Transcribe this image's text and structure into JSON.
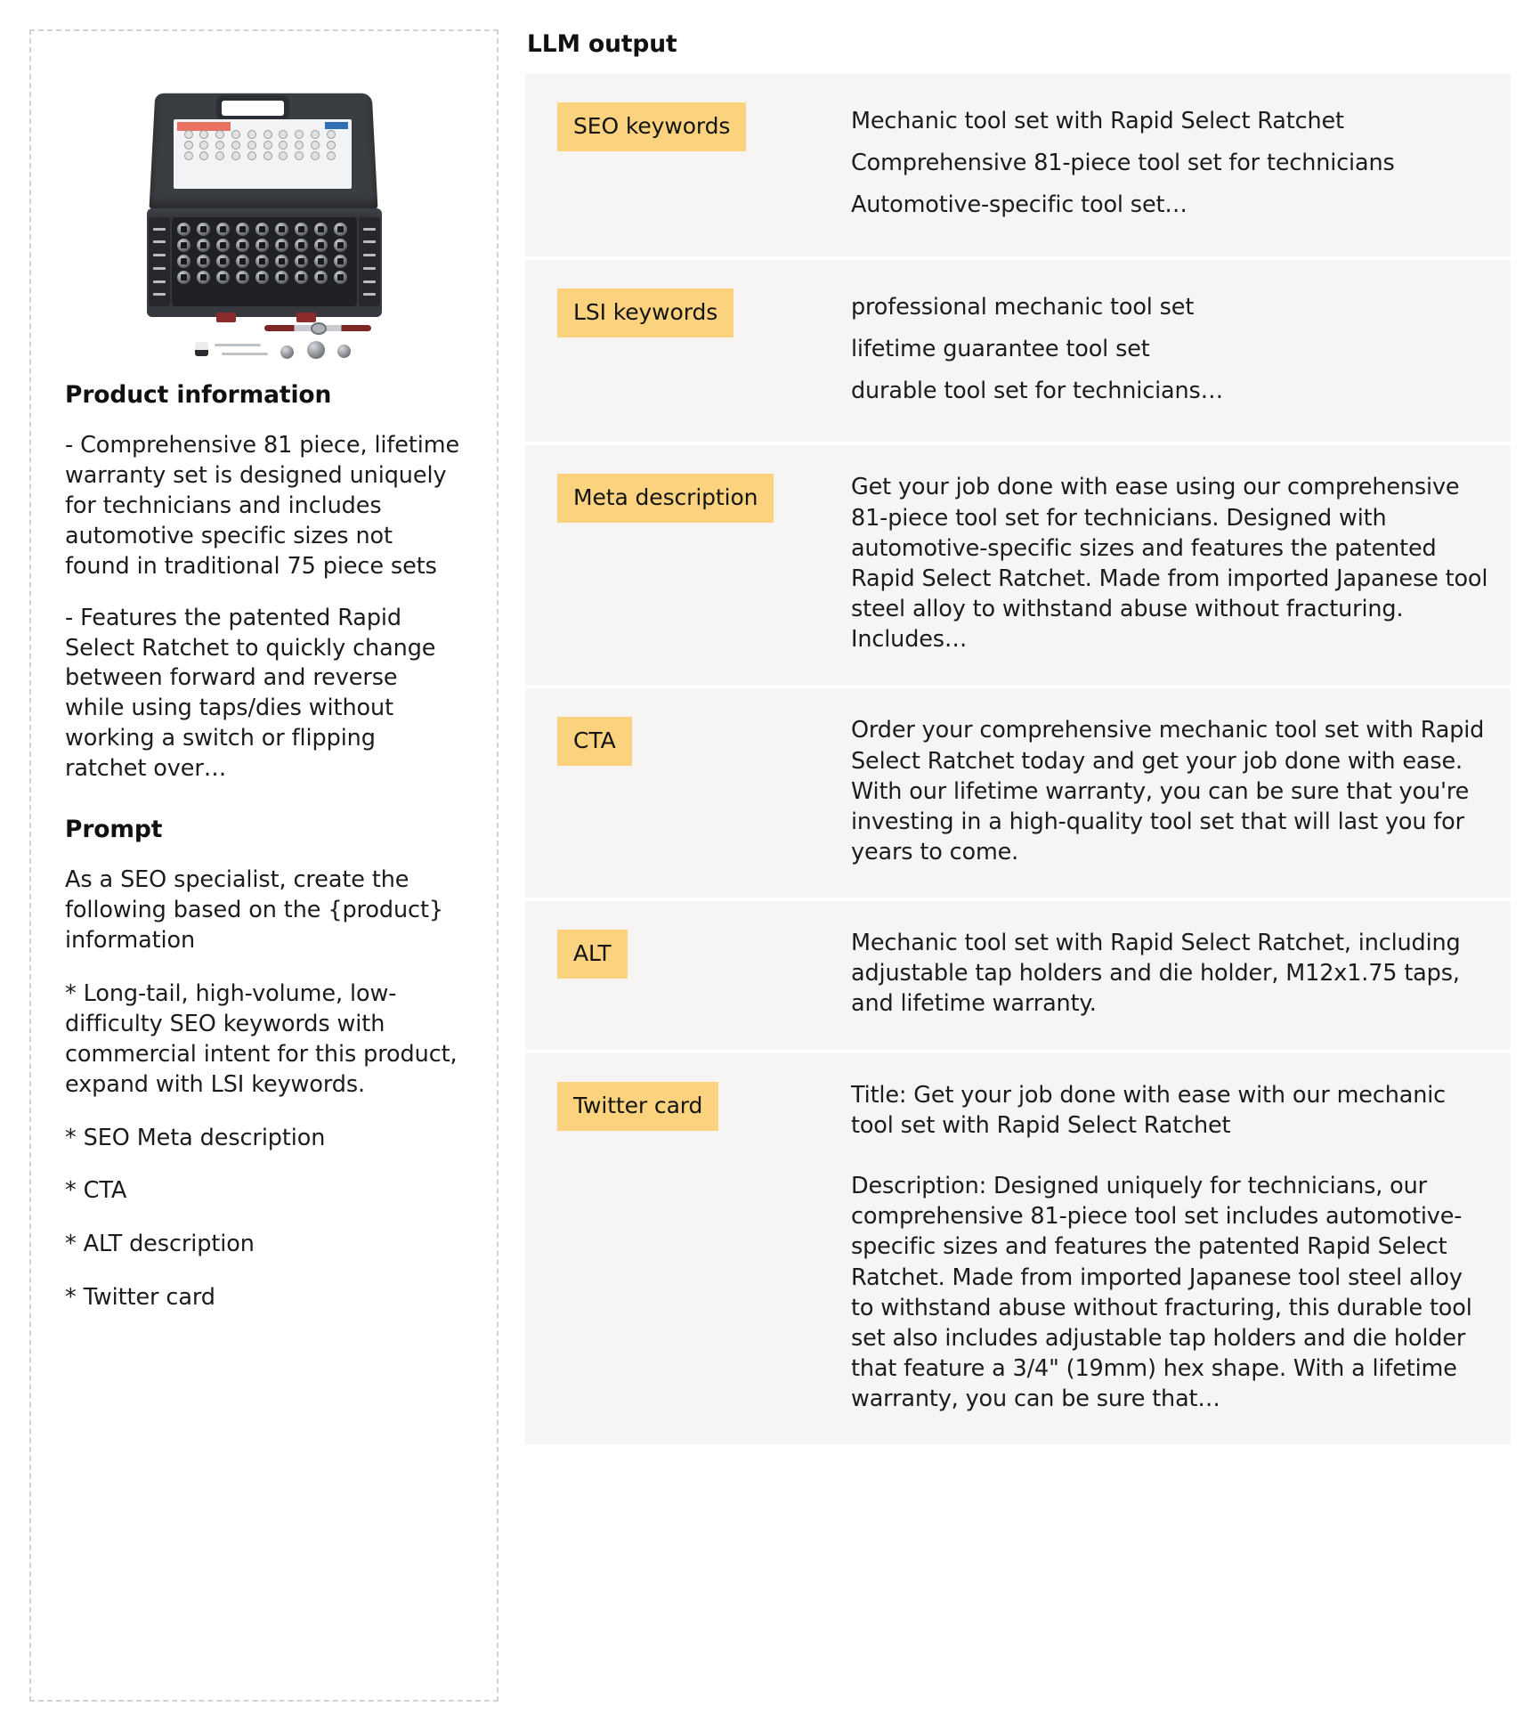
{
  "left_panel": {
    "product_image_alt": "product-image-tool-set",
    "product_information": {
      "heading": "Product information",
      "bullets": [
        "- Comprehensive 81 piece, lifetime warranty set is designed uniquely for technicians and includes automotive specific sizes not found in traditional 75 piece sets",
        "- Features the patented Rapid Select Ratchet to quickly change between forward and reverse while using taps/dies without working a switch or flipping ratchet over…"
      ]
    },
    "prompt": {
      "heading": "Prompt",
      "lines": [
        "As a SEO specialist, create the following based on the {product} information",
        "* Long-tail, high-volume, low-difficulty SEO keywords with commercial intent for this product, expand with LSI keywords.",
        "* SEO Meta description",
        "* CTA",
        "* ALT description",
        "* Twitter card"
      ]
    }
  },
  "right_panel": {
    "title": "LLM output",
    "badge_color": "#fbd27d",
    "row_background": "#f6f5f4",
    "rows": [
      {
        "label": "SEO keywords",
        "style": "lines",
        "lines": [
          "Mechanic tool set with Rapid Select Ratchet",
          "Comprehensive 81-piece tool set for technicians",
          "Automotive-specific tool set…"
        ]
      },
      {
        "label": "LSI keywords",
        "style": "lines",
        "lines": [
          "professional mechanic tool set",
          "lifetime guarantee tool set",
          "durable tool set for technicians…"
        ]
      },
      {
        "label": "Meta description",
        "style": "paragraphs",
        "paragraphs": [
          "Get your job done with ease using our comprehensive 81-piece tool set for technicians. Designed with automotive-specific sizes and features the patented Rapid Select Ratchet. Made from imported Japanese tool steel alloy to withstand abuse without fracturing. Includes…"
        ]
      },
      {
        "label": "CTA",
        "style": "paragraphs",
        "paragraphs": [
          "Order your comprehensive mechanic tool set with Rapid Select Ratchet today and get your job done with ease. With our lifetime warranty, you can be sure that you're investing in a high-quality tool set that will last you for years to come."
        ]
      },
      {
        "label": "ALT",
        "style": "paragraphs",
        "paragraphs": [
          "Mechanic tool set with Rapid Select Ratchet, including adjustable tap holders and die holder, M12x1.75 taps, and lifetime warranty."
        ]
      },
      {
        "label": "Twitter card",
        "style": "paragraphs",
        "paragraphs": [
          "Title: Get your job done with ease with our mechanic tool set with Rapid Select Ratchet",
          "Description: Designed uniquely for technicians, our comprehensive 81-piece tool set includes automotive-specific sizes and features the patented Rapid Select Ratchet. Made from imported Japanese tool steel alloy to withstand abuse without fracturing, this durable tool set also includes adjustable tap holders and die holder that feature a 3/4\" (19mm) hex shape. With a lifetime warranty, you can be sure that…"
        ]
      }
    ]
  }
}
